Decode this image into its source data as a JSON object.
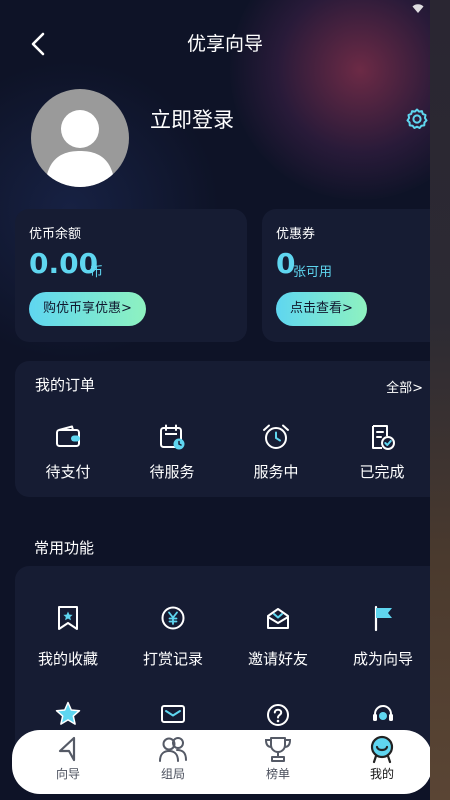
{
  "header": {
    "title": "优享向导",
    "back_icon": "back-arrow-icon"
  },
  "profile": {
    "login_text": "立即登录",
    "settings_icon": "gear-icon"
  },
  "balance_card": {
    "label": "优币余额",
    "amount": "0.00",
    "unit": "币",
    "button": "购优币享优惠>"
  },
  "coupon_card": {
    "label": "优惠券",
    "count": "0",
    "unit": "张可用",
    "button": "点击查看>"
  },
  "orders": {
    "title": "我的订单",
    "all_link": "全部>",
    "items": [
      {
        "label": "待支付",
        "icon": "wallet-icon"
      },
      {
        "label": "待服务",
        "icon": "calendar-icon"
      },
      {
        "label": "服务中",
        "icon": "alarm-clock-icon"
      },
      {
        "label": "已完成",
        "icon": "completed-document-icon"
      }
    ]
  },
  "common": {
    "title": "常用功能",
    "items": [
      {
        "label": "我的收藏",
        "icon": "bookmark-star-icon"
      },
      {
        "label": "打赏记录",
        "icon": "yen-coin-icon"
      },
      {
        "label": "邀请好友",
        "icon": "invite-mail-icon"
      },
      {
        "label": "成为向导",
        "icon": "flag-icon"
      },
      {
        "label": "",
        "icon": "star-icon"
      },
      {
        "label": "",
        "icon": "envelope-icon"
      },
      {
        "label": "",
        "icon": "help-question-icon"
      },
      {
        "label": "",
        "icon": "customer-service-icon"
      }
    ]
  },
  "tabbar": {
    "items": [
      {
        "label": "向导",
        "icon": "navigation-arrow-icon"
      },
      {
        "label": "组局",
        "icon": "group-people-icon"
      },
      {
        "label": "榜单",
        "icon": "trophy-icon"
      },
      {
        "label": "我的",
        "icon": "my-profile-icon",
        "active": true
      }
    ]
  },
  "colors": {
    "accent": "#5fd6f0",
    "accent_end": "#8ef2c0",
    "background": "#0e1327",
    "card": "#161c33"
  }
}
